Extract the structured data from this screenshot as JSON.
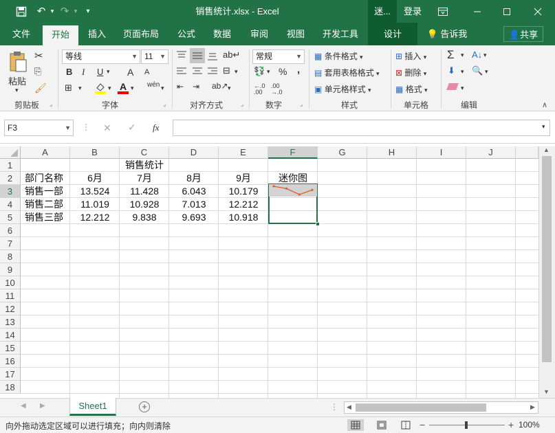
{
  "title_bar": {
    "window_title": "销售统计.xlsx - Excel",
    "context_tab": "迷...",
    "login": "登录"
  },
  "tabs": [
    {
      "label": "文件"
    },
    {
      "label": "开始"
    },
    {
      "label": "插入"
    },
    {
      "label": "页面布局"
    },
    {
      "label": "公式"
    },
    {
      "label": "数据"
    },
    {
      "label": "审阅"
    },
    {
      "label": "视图"
    },
    {
      "label": "开发工具"
    },
    {
      "label": "设计"
    }
  ],
  "tell_me": "告诉我",
  "share": "共享",
  "ribbon": {
    "clipboard": {
      "paste": "粘贴",
      "group": "剪贴板"
    },
    "font": {
      "name": "等线",
      "size": "11",
      "group": "字体",
      "bold": "B",
      "italic": "I",
      "underline": "U",
      "grow": "A",
      "shrink": "A",
      "wen": "wén"
    },
    "alignment": {
      "group": "对齐方式"
    },
    "number": {
      "format": "常规",
      "group": "数字",
      "percent": "%",
      "comma": ","
    },
    "styles": {
      "conditional": "条件格式",
      "table": "套用表格格式",
      "cell": "单元格样式",
      "group": "样式"
    },
    "cells": {
      "insert": "插入",
      "delete": "删除",
      "format": "格式",
      "group": "单元格"
    },
    "editing": {
      "group": "编辑"
    }
  },
  "formula_bar": {
    "name_box": "F3",
    "fx": "fx",
    "value": ""
  },
  "columns": [
    "A",
    "B",
    "C",
    "D",
    "E",
    "F",
    "G",
    "H",
    "I",
    "J"
  ],
  "selected_column": "F",
  "rows": [
    "1",
    "2",
    "3",
    "4",
    "5",
    "6",
    "7",
    "8",
    "9",
    "10",
    "11",
    "12",
    "13",
    "14",
    "15",
    "16",
    "17",
    "18"
  ],
  "selected_rows": [
    "3"
  ],
  "cells": {
    "r1_title": "销售统计",
    "r2": [
      "部门名称",
      "6月",
      "7月",
      "8月",
      "9月",
      "迷你图"
    ],
    "data": [
      [
        "销售一部",
        "13.524",
        "11.428",
        "6.043",
        "10.179"
      ],
      [
        "销售二部",
        "11.019",
        "10.928",
        "7.013",
        "12.212"
      ],
      [
        "销售三部",
        "12.212",
        "9.838",
        "9.693",
        "10.918"
      ]
    ]
  },
  "sparkline": {
    "values": [
      13.524,
      11.428,
      6.043,
      10.179
    ],
    "color": "#d9622b"
  },
  "sheet_tab": "Sheet1",
  "status_text": "向外拖动选定区域可以进行填充；向内则清除",
  "zoom": "100%",
  "colors": {
    "brand": "#217346",
    "ribbon_bg": "#f3f3f3",
    "selection": "#217346"
  }
}
